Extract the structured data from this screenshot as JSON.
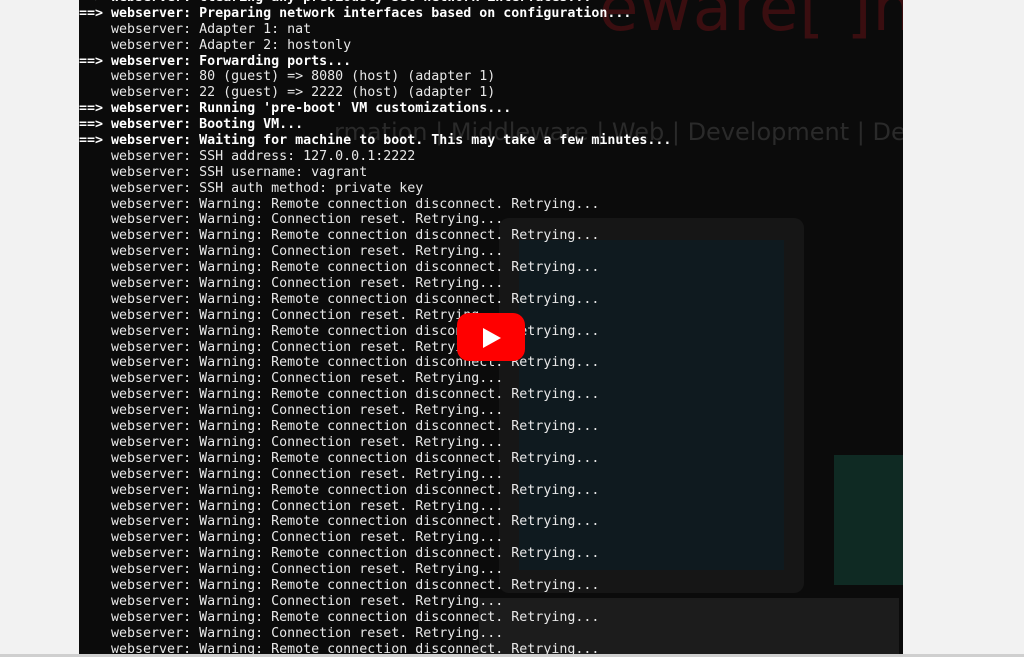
{
  "background": {
    "brand_text": "eware[ ]nventory",
    "tagline": "rmation | Middleware | Web | Development | DevOps"
  },
  "terminal": {
    "lines": [
      {
        "text": "==> webserver: Clearing any previously set network interfaces...",
        "bold": true
      },
      {
        "text": "==> webserver: Preparing network interfaces based on configuration...",
        "bold": true
      },
      {
        "text": "    webserver: Adapter 1: nat",
        "bold": false
      },
      {
        "text": "    webserver: Adapter 2: hostonly",
        "bold": false
      },
      {
        "text": "==> webserver: Forwarding ports...",
        "bold": true
      },
      {
        "text": "    webserver: 80 (guest) => 8080 (host) (adapter 1)",
        "bold": false
      },
      {
        "text": "    webserver: 22 (guest) => 2222 (host) (adapter 1)",
        "bold": false
      },
      {
        "text": "==> webserver: Running 'pre-boot' VM customizations...",
        "bold": true
      },
      {
        "text": "==> webserver: Booting VM...",
        "bold": true
      },
      {
        "text": "==> webserver: Waiting for machine to boot. This may take a few minutes...",
        "bold": true
      },
      {
        "text": "    webserver: SSH address: 127.0.0.1:2222",
        "bold": false
      },
      {
        "text": "    webserver: SSH username: vagrant",
        "bold": false
      },
      {
        "text": "    webserver: SSH auth method: private key",
        "bold": false
      },
      {
        "text": "    webserver: Warning: Remote connection disconnect. Retrying...",
        "bold": false
      },
      {
        "text": "    webserver: Warning: Connection reset. Retrying...",
        "bold": false
      },
      {
        "text": "    webserver: Warning: Remote connection disconnect. Retrying...",
        "bold": false
      },
      {
        "text": "    webserver: Warning: Connection reset. Retrying...",
        "bold": false
      },
      {
        "text": "    webserver: Warning: Remote connection disconnect. Retrying...",
        "bold": false
      },
      {
        "text": "    webserver: Warning: Connection reset. Retrying...",
        "bold": false
      },
      {
        "text": "    webserver: Warning: Remote connection disconnect. Retrying...",
        "bold": false
      },
      {
        "text": "    webserver: Warning: Connection reset. Retrying...",
        "bold": false
      },
      {
        "text": "    webserver: Warning: Remote connection disconnect. Retrying...",
        "bold": false
      },
      {
        "text": "    webserver: Warning: Connection reset. Retrying...",
        "bold": false
      },
      {
        "text": "    webserver: Warning: Remote connection disconnect. Retrying...",
        "bold": false
      },
      {
        "text": "    webserver: Warning: Connection reset. Retrying...",
        "bold": false
      },
      {
        "text": "    webserver: Warning: Remote connection disconnect. Retrying...",
        "bold": false
      },
      {
        "text": "    webserver: Warning: Connection reset. Retrying...",
        "bold": false
      },
      {
        "text": "    webserver: Warning: Remote connection disconnect. Retrying...",
        "bold": false
      },
      {
        "text": "    webserver: Warning: Connection reset. Retrying...",
        "bold": false
      },
      {
        "text": "    webserver: Warning: Remote connection disconnect. Retrying...",
        "bold": false
      },
      {
        "text": "    webserver: Warning: Connection reset. Retrying...",
        "bold": false
      },
      {
        "text": "    webserver: Warning: Remote connection disconnect. Retrying...",
        "bold": false
      },
      {
        "text": "    webserver: Warning: Connection reset. Retrying...",
        "bold": false
      },
      {
        "text": "    webserver: Warning: Remote connection disconnect. Retrying...",
        "bold": false
      },
      {
        "text": "    webserver: Warning: Connection reset. Retrying...",
        "bold": false
      },
      {
        "text": "    webserver: Warning: Remote connection disconnect. Retrying...",
        "bold": false
      },
      {
        "text": "    webserver: Warning: Connection reset. Retrying...",
        "bold": false
      },
      {
        "text": "    webserver: Warning: Remote connection disconnect. Retrying...",
        "bold": false
      },
      {
        "text": "    webserver: Warning: Connection reset. Retrying...",
        "bold": false
      },
      {
        "text": "    webserver: Warning: Remote connection disconnect. Retrying...",
        "bold": false
      },
      {
        "text": "    webserver: Warning: Connection reset. Retrying...",
        "bold": false
      },
      {
        "text": "    webserver: Warning: Remote connection disconnect. Retrying...",
        "bold": false
      }
    ]
  },
  "player": {
    "play_button_icon": "youtube-play-icon",
    "play_button_color": "#ff0000"
  }
}
